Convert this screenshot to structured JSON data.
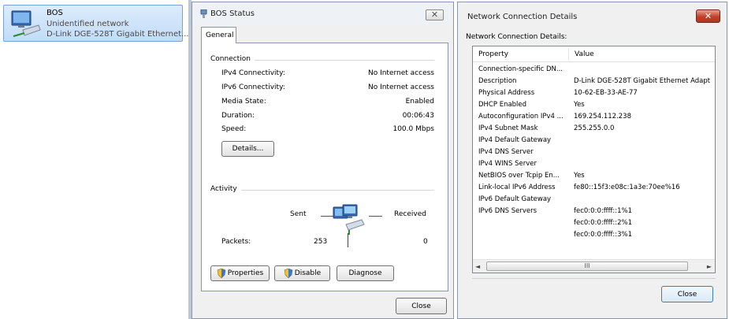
{
  "network_list": {
    "name": "BOS",
    "status": "Unidentified network",
    "adapter": "D-Link DGE-528T Gigabit Ethernet..."
  },
  "status_window": {
    "title": "BOS Status",
    "close_glyph": "✕",
    "tab_general": "General",
    "connection": {
      "group_label": "Connection",
      "ipv4_label": "IPv4 Connectivity:",
      "ipv4_value": "No Internet access",
      "ipv6_label": "IPv6 Connectivity:",
      "ipv6_value": "No Internet access",
      "media_label": "Media State:",
      "media_value": "Enabled",
      "duration_label": "Duration:",
      "duration_value": "00:06:43",
      "speed_label": "Speed:",
      "speed_value": "100.0 Mbps",
      "details_button": "Details..."
    },
    "activity": {
      "group_label": "Activity",
      "sent_label": "Sent",
      "received_label": "Received",
      "packets_label": "Packets:",
      "packets_sent": "253",
      "packets_received": "0"
    },
    "buttons": {
      "properties": "Properties",
      "disable": "Disable",
      "diagnose": "Diagnose",
      "close": "Close"
    }
  },
  "details_window": {
    "title": "Network Connection Details",
    "close_glyph": "✕",
    "heading": "Network Connection Details:",
    "columns": {
      "property": "Property",
      "value": "Value"
    },
    "rows": [
      {
        "property": "Connection-specific DN...",
        "value": ""
      },
      {
        "property": "Description",
        "value": "D-Link DGE-528T Gigabit Ethernet Adapt"
      },
      {
        "property": "Physical Address",
        "value": "10-62-EB-33-AE-77"
      },
      {
        "property": "DHCP Enabled",
        "value": "Yes"
      },
      {
        "property": "Autoconfiguration IPv4 ...",
        "value": "169.254.112.238"
      },
      {
        "property": "IPv4 Subnet Mask",
        "value": "255.255.0.0"
      },
      {
        "property": "IPv4 Default Gateway",
        "value": ""
      },
      {
        "property": "IPv4 DNS Server",
        "value": ""
      },
      {
        "property": "IPv4 WINS Server",
        "value": ""
      },
      {
        "property": "NetBIOS over Tcpip En...",
        "value": "Yes"
      },
      {
        "property": "Link-local IPv6 Address",
        "value": "fe80::15f3:e08c:1a3e:70ee%16"
      },
      {
        "property": "IPv6 Default Gateway",
        "value": ""
      },
      {
        "property": "IPv6 DNS Servers",
        "value": "fec0:0:0:ffff::1%1"
      },
      {
        "property": "",
        "value": "fec0:0:0:ffff::2%1"
      },
      {
        "property": "",
        "value": "fec0:0:0:ffff::3%1"
      }
    ],
    "scroll": {
      "left": "◄",
      "right": "►",
      "thumb_grip": "III"
    },
    "close_button": "Close"
  },
  "colors": {
    "selection": "#c2dcf7",
    "window_bg": "#f0f0f0",
    "close_red": "#c0412b"
  },
  "icons": [
    "network-adapter-icon",
    "network-activity-icon",
    "status-network-icon",
    "uac-shield-icon"
  ]
}
